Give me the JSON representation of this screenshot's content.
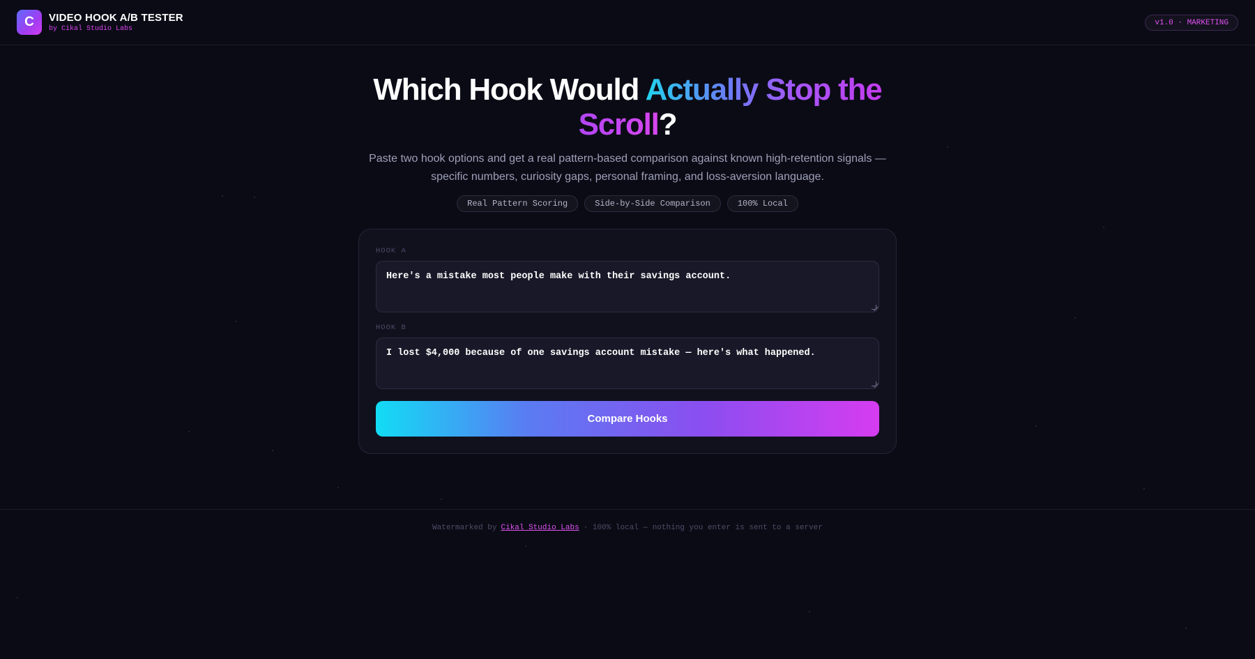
{
  "header": {
    "logo_letter": "C",
    "title": "VIDEO HOOK A/B TESTER",
    "subtitle": "by Cikal Studio Labs",
    "version_badge": "v1.0 · MARKETING"
  },
  "hero": {
    "title_part1": "Which Hook Would ",
    "title_highlight": "Actually Stop the",
    "title_highlight2": "Scroll",
    "title_end": "?",
    "description": "Paste two hook options and get a real pattern-based comparison against known high-retention signals — specific numbers, curiosity gaps, personal framing, and loss-aversion language.",
    "chips": [
      "Real Pattern Scoring",
      "Side-by-Side Comparison",
      "100% Local"
    ]
  },
  "form": {
    "hook_a_label": "HOOK A",
    "hook_a_value": "Here's a mistake most people make with their savings account.",
    "hook_b_label": "HOOK B",
    "hook_b_value": "I lost $4,000 because of one savings account mistake — here's what happened.",
    "compare_button": "Compare Hooks"
  },
  "footer": {
    "prefix": "Watermarked by",
    "link": "Cikal Studio Labs",
    "suffix": "· 100% local — nothing you enter is sent to a server"
  },
  "colors": {
    "background": "#0b0b16",
    "accent_cyan": "#22d3ee",
    "accent_magenta": "#d946ef"
  }
}
